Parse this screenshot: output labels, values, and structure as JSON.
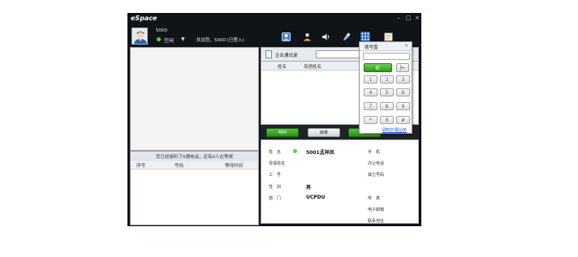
{
  "app": {
    "title": "eSpace",
    "controls": [
      "–",
      "□",
      "×"
    ]
  },
  "user": {
    "number": "5000",
    "status": "空闲",
    "welcome": "欢迎您，5000 (已登入)"
  },
  "toolbar": {
    "icons": [
      "contacts-icon",
      "meeting-icon",
      "volume-icon",
      "microphone-icon",
      "dialpad-icon",
      "notes-icon"
    ]
  },
  "queue": {
    "summary": "您已经接听了0通电话，还有0人在等候",
    "headers": [
      "序号",
      "号码",
      "等待时间"
    ]
  },
  "directory": {
    "label": "企业通讯录",
    "headers": [
      "姓名",
      "母语姓名"
    ]
  },
  "actions": {
    "call": "呼叫",
    "transfer": "转移",
    "hangup": "挂断"
  },
  "detail": {
    "left": [
      {
        "label": "姓　名",
        "value": "5001孟祥凤"
      },
      {
        "label": "母语姓名",
        "value": ""
      },
      {
        "label": "工　号",
        "value": ""
      },
      {
        "label": "性　别",
        "value": "男"
      },
      {
        "label": "部　门",
        "value": "UCPDU"
      }
    ],
    "right": [
      "手　机",
      "办公电话",
      "其它号码",
      "传　真",
      "电子邮箱",
      "联系地址"
    ]
  },
  "dialpad": {
    "title": "拨号盘",
    "close": "×",
    "call_symbol": "✆",
    "backspace": "|←",
    "keys": [
      "1",
      "2",
      "3",
      "4",
      "5",
      "6",
      "7",
      "8",
      "9",
      "*",
      "0",
      "#"
    ],
    "link": "即时扩展业务"
  }
}
